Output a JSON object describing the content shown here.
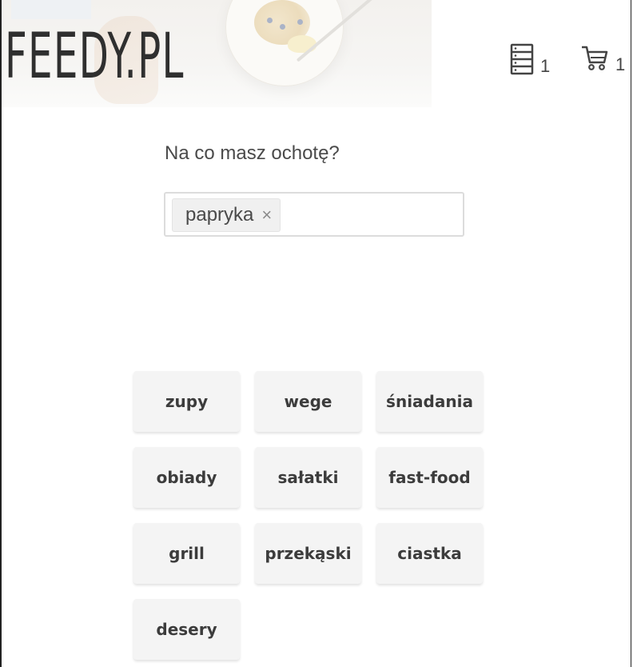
{
  "header": {
    "logo_text": "FEEDY.PL",
    "list_count": "1",
    "cart_count": "1"
  },
  "icons": {
    "list": "list-icon",
    "cart": "cart-icon",
    "remove": "close-icon"
  },
  "search": {
    "question": "Na co masz ochotę?",
    "tags": [
      {
        "label": "papryka",
        "remove": "×"
      }
    ]
  },
  "categories": [
    "zupy",
    "wege",
    "śniadania",
    "obiady",
    "sałatki",
    "fast-food",
    "grill",
    "przekąski",
    "ciastka",
    "desery"
  ],
  "colors": {
    "text": "#4a4a4a",
    "button_bg": "#f4f4f4",
    "tag_bg": "#f0f0f0",
    "input_border": "#dcdcdc"
  }
}
